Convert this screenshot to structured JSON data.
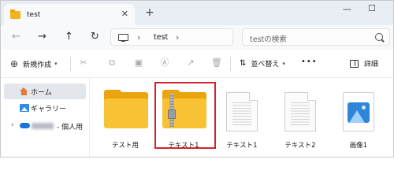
{
  "tab": {
    "title": "test"
  },
  "nav": {
    "path": "test"
  },
  "search": {
    "placeholder": "testの検索"
  },
  "toolbar": {
    "new_label": "新規作成",
    "sort_label": "並べ替え",
    "more_label": "•••",
    "details_label": "詳細"
  },
  "sidebar": {
    "items": [
      {
        "label": "ホーム",
        "icon": "home-icon",
        "selected": true
      },
      {
        "label": "ギャラリー",
        "icon": "gallery-icon",
        "selected": false
      },
      {
        "label": "- 個人用",
        "icon": "onedrive-icon",
        "selected": false
      }
    ]
  },
  "files": [
    {
      "name": "テスト用",
      "type": "folder"
    },
    {
      "name": "テキスト1",
      "type": "zip-folder",
      "highlighted": true
    },
    {
      "name": "テキスト1",
      "type": "text-file"
    },
    {
      "name": "テキスト2",
      "type": "text-file"
    },
    {
      "name": "画像1",
      "type": "image-file"
    }
  ],
  "colors": {
    "highlight": "#d3242b",
    "folder": "#f7c234",
    "accent": "#2f86d8"
  }
}
